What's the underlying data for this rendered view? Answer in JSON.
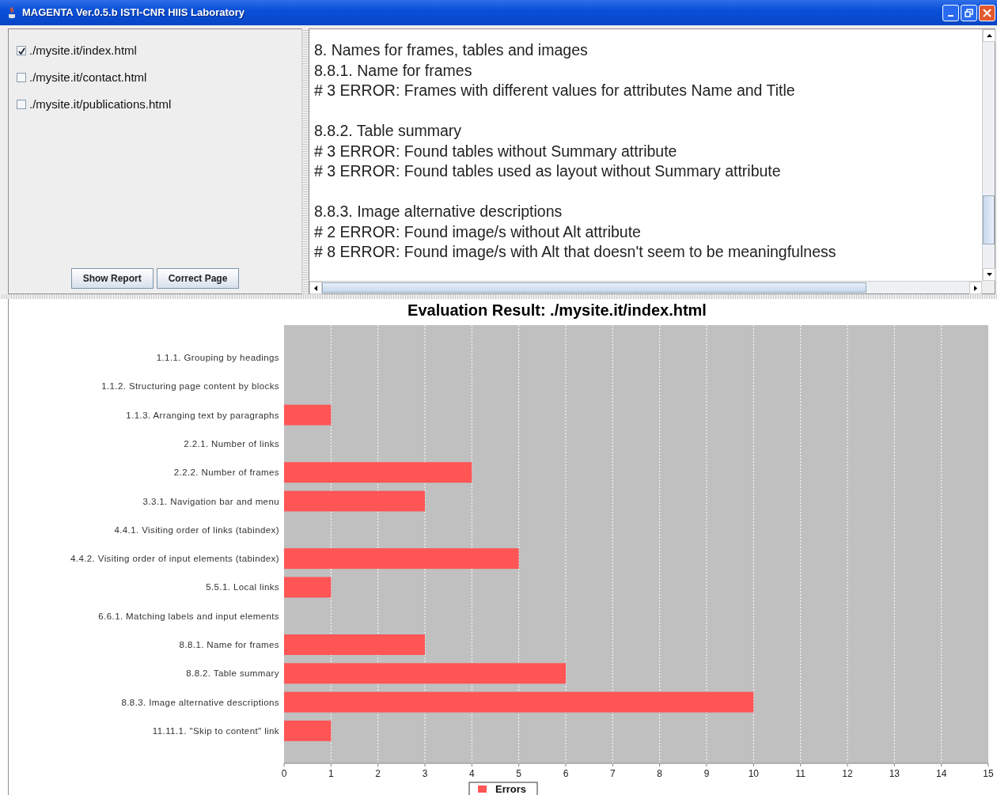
{
  "window": {
    "title": "MAGENTA Ver.0.5.b ISTI-CNR HIIS Laboratory"
  },
  "pages": [
    {
      "label": "./mysite.it/index.html",
      "checked": true
    },
    {
      "label": "./mysite.it/contact.html",
      "checked": false
    },
    {
      "label": "./mysite.it/publications.html",
      "checked": false
    }
  ],
  "buttons": [
    "Show Report",
    "Correct Page"
  ],
  "report": {
    "heading": "8. Names for frames, tables and images",
    "sections": [
      {
        "title": "8.8.1. Name for frames",
        "lines": [
          "# 3 ERROR: Frames with different values for attributes Name and Title"
        ]
      },
      {
        "title": "8.8.2. Table summary",
        "lines": [
          "# 3 ERROR: Found tables without Summary attribute",
          "# 3 ERROR: Found tables used as layout without Summary attribute"
        ]
      },
      {
        "title": "8.8.3. Image alternative descriptions",
        "lines": [
          "# 2 ERROR: Found image/s without Alt attribute",
          "# 8 ERROR: Found image/s with Alt that doesn't seem to be meaningfulness"
        ]
      }
    ]
  },
  "chart": {
    "chart_data": {
      "type": "bar",
      "orientation": "horizontal",
      "title": "Evaluation Result: ./mysite.it/index.html",
      "categories": [
        "1.1.1. Grouping by headings",
        "1.1.2. Structuring page content by blocks",
        "1.1.3. Arranging text by paragraphs",
        "2.2.1. Number of links",
        "2.2.2. Number of frames",
        "3.3.1. Navigation bar and menu",
        "4.4.1. Visiting order of links (tabindex)",
        "4.4.2. Visiting order of input elements (tabindex)",
        "5.5.1. Local links",
        "6.6.1. Matching labels and input elements",
        "8.8.1. Name for frames",
        "8.8.2. Table summary",
        "8.8.3. Image alternative descriptions",
        "11.11.1. \"Skip to content\" link"
      ],
      "series": [
        {
          "name": "Errors",
          "color": "#ff5555",
          "values": [
            0,
            0,
            1,
            0,
            4,
            3,
            0,
            5,
            1,
            0,
            3,
            6,
            10,
            1
          ]
        }
      ],
      "grid": true,
      "xlim": [
        0,
        15
      ],
      "xticks": [
        0,
        1,
        2,
        3,
        4,
        5,
        6,
        7,
        8,
        9,
        10,
        11,
        12,
        13,
        14,
        15
      ]
    }
  }
}
